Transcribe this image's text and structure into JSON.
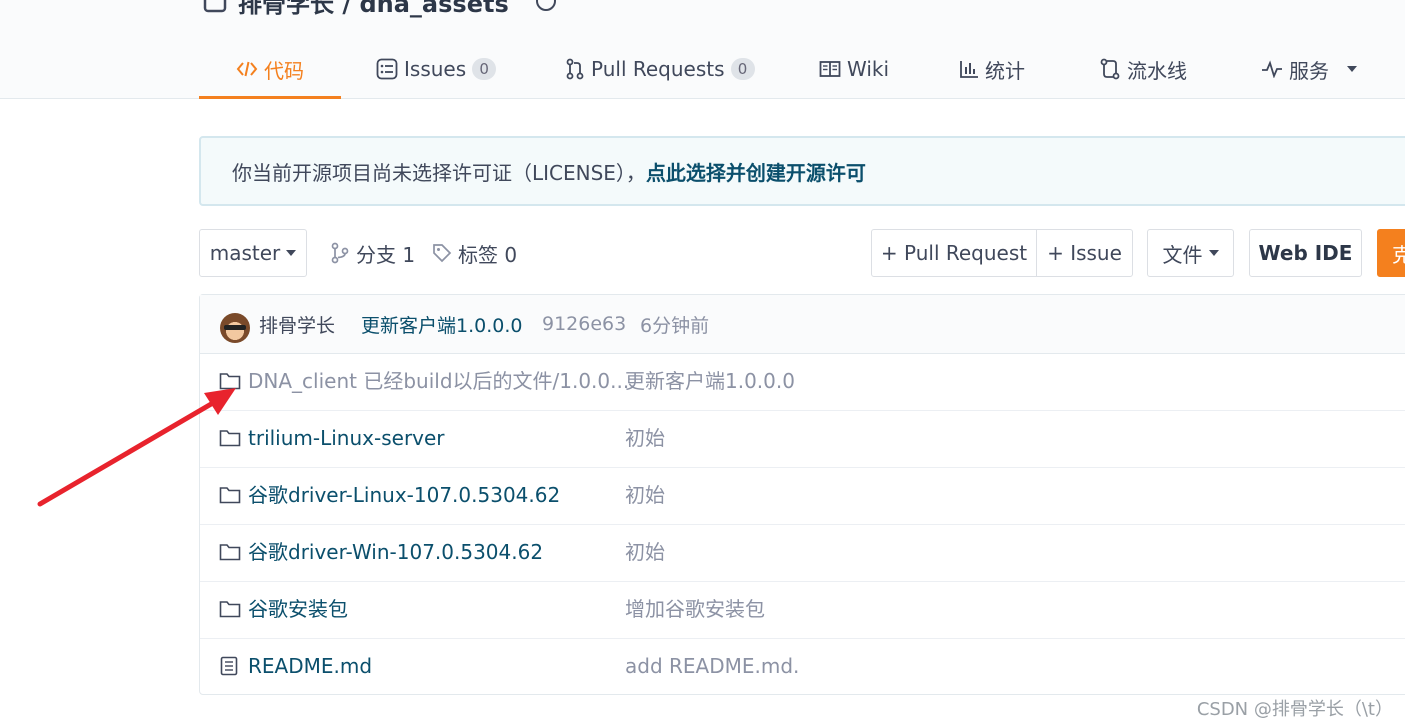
{
  "repo": {
    "title": "排骨学长 / dna_assets"
  },
  "tabs": [
    {
      "label": "代码",
      "icon": "code-icon",
      "active": true
    },
    {
      "label": "Issues",
      "icon": "issues-icon",
      "count": "0"
    },
    {
      "label": "Pull Requests",
      "icon": "pull-request-icon",
      "count": "0"
    },
    {
      "label": "Wiki",
      "icon": "wiki-book-icon"
    },
    {
      "label": "统计",
      "icon": "bar-chart-icon"
    },
    {
      "label": "流水线",
      "icon": "pipeline-icon"
    },
    {
      "label": "服务",
      "icon": "pulse-icon"
    }
  ],
  "notice": {
    "text": "你当前开源项目尚未选择许可证（LICENSE），",
    "link": "点此选择并创建开源许可"
  },
  "toolbar": {
    "branch": "master",
    "branches_label": "分支 1",
    "tags_label": "标签 0",
    "pull_request_button": "+ Pull Request",
    "issue_button": "+ Issue",
    "file_menu": "文件",
    "web_ide_button": "Web IDE",
    "clone_button_partial": "克"
  },
  "latest_commit": {
    "author": "排骨学长",
    "message": "更新客户端1.0.0.0",
    "hash": "9126e63",
    "time": "6分钟前"
  },
  "files": [
    {
      "type": "folder",
      "name": "DNA_client 已经build以后的文件/1.0.0....",
      "message": "更新客户端1.0.0.0"
    },
    {
      "type": "folder",
      "name": "trilium-Linux-server",
      "message": "初始"
    },
    {
      "type": "folder",
      "name": "谷歌driver-Linux-107.0.5304.62",
      "message": "初始"
    },
    {
      "type": "folder",
      "name": "谷歌driver-Win-107.0.5304.62",
      "message": "初始"
    },
    {
      "type": "folder",
      "name": "谷歌安装包",
      "message": "增加谷歌安装包"
    },
    {
      "type": "file",
      "name": "README.md",
      "message": "add README.md."
    }
  ],
  "watermark": "CSDN @排骨学长（\\t）",
  "colors": {
    "accent": "#f4801e",
    "link": "#0b4f6c",
    "annotation_arrow": "#e8232d"
  }
}
